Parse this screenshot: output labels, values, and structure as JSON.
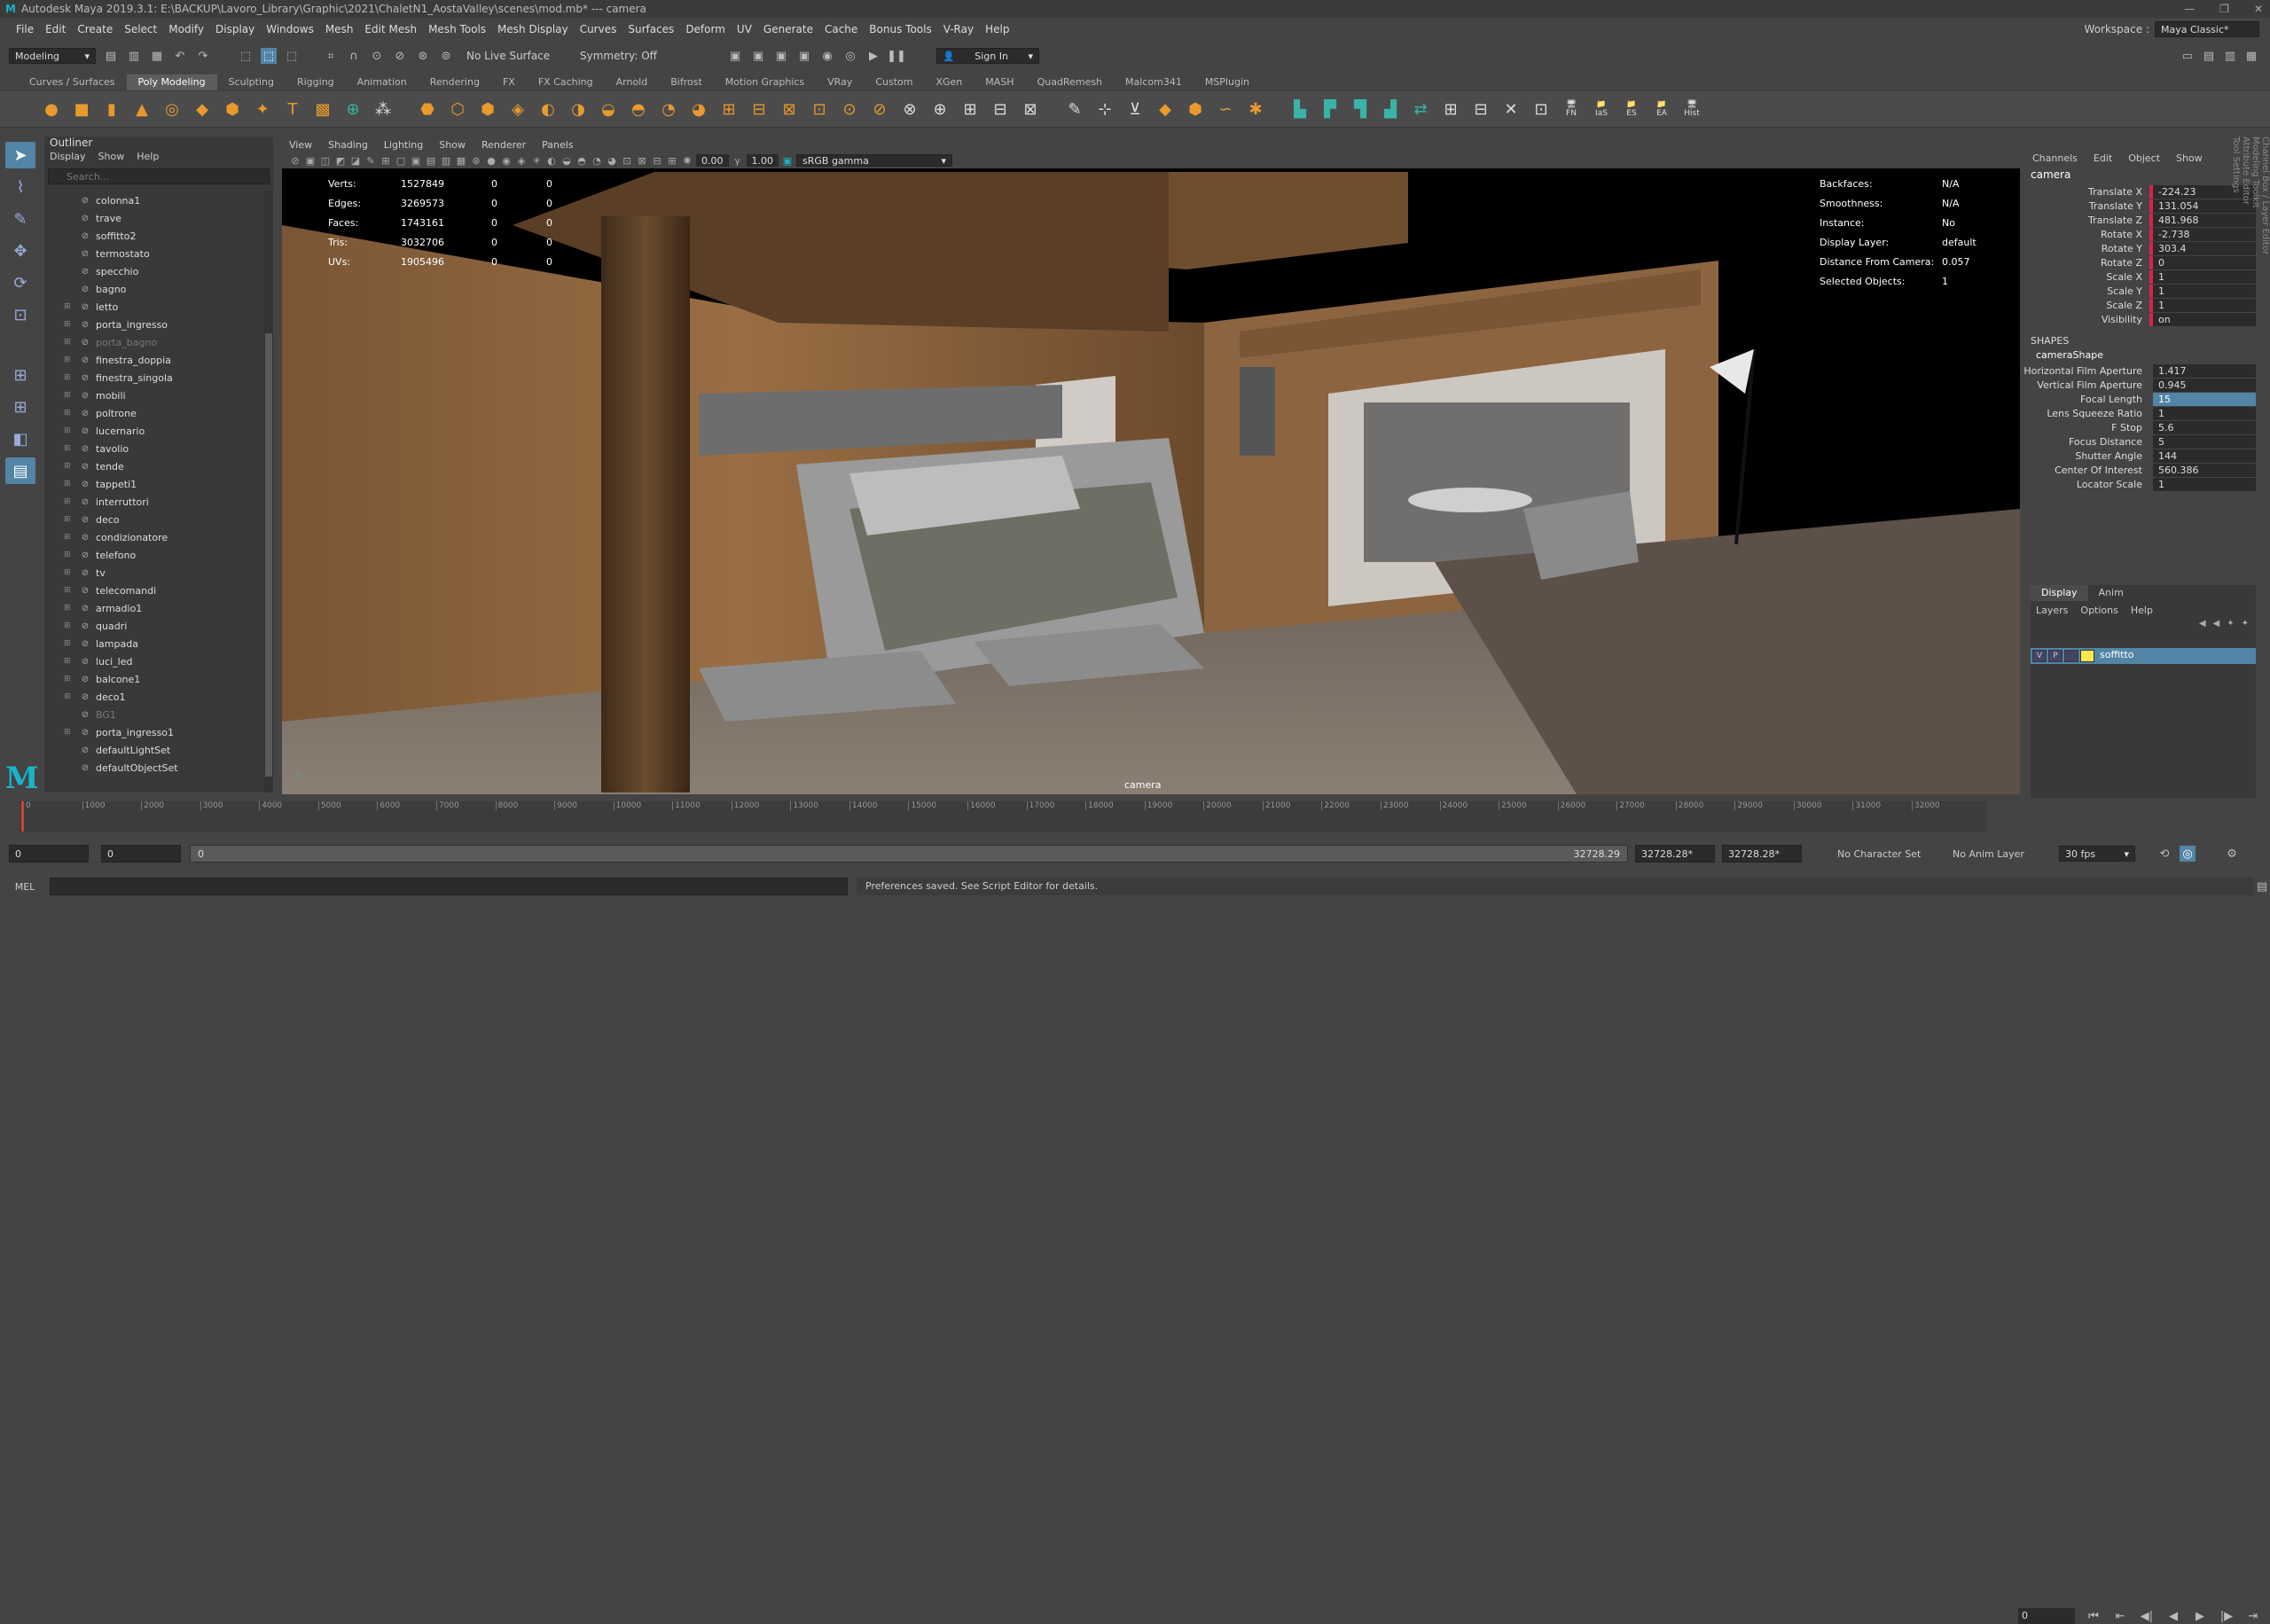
{
  "titlebar": {
    "logo": "M",
    "text": "Autodesk Maya 2019.3.1: E:\\BACKUP\\Lavoro_Library\\Graphic\\2021\\ChaletN1_AostaValley\\scenes\\mod.mb*   ---   camera"
  },
  "menus": [
    "File",
    "Edit",
    "Create",
    "Select",
    "Modify",
    "Display",
    "Windows",
    "Mesh",
    "Edit Mesh",
    "Mesh Tools",
    "Mesh Display",
    "Curves",
    "Surfaces",
    "Deform",
    "UV",
    "Generate",
    "Cache",
    "Bonus Tools",
    "V-Ray",
    "Help"
  ],
  "workspace": {
    "label": "Workspace :",
    "value": "Maya Classic*"
  },
  "statusline": {
    "mode": "Modeling",
    "live": "No Live Surface",
    "symmetry": "Symmetry: Off",
    "signin": "Sign In"
  },
  "shelf_tabs": [
    "Curves / Surfaces",
    "Poly Modeling",
    "Sculpting",
    "Rigging",
    "Animation",
    "Rendering",
    "FX",
    "FX Caching",
    "Arnold",
    "Bifrost",
    "Motion Graphics",
    "VRay",
    "Custom",
    "XGen",
    "MASH",
    "QuadRemesh",
    "Malcom341",
    "MSPlugin"
  ],
  "shelf_labels": {
    "fn": "FN",
    "ias": "IaS",
    "es": "ES",
    "ea": "EA",
    "hist": "Hist"
  },
  "outliner": {
    "title": "Outliner",
    "menu": [
      "Display",
      "Show",
      "Help"
    ],
    "search_placeholder": "Search...",
    "items": [
      {
        "name": "colonna1",
        "expand": false,
        "dim": false
      },
      {
        "name": "trave",
        "expand": false,
        "dim": false
      },
      {
        "name": "soffitto2",
        "expand": false,
        "dim": false
      },
      {
        "name": "termostato",
        "expand": false,
        "dim": false
      },
      {
        "name": "specchio",
        "expand": false,
        "dim": false
      },
      {
        "name": "bagno",
        "expand": false,
        "dim": false
      },
      {
        "name": "letto",
        "expand": true,
        "dim": false
      },
      {
        "name": "porta_ingresso",
        "expand": true,
        "dim": false
      },
      {
        "name": "porta_bagno",
        "expand": true,
        "dim": true
      },
      {
        "name": "finestra_doppia",
        "expand": true,
        "dim": false
      },
      {
        "name": "finestra_singola",
        "expand": true,
        "dim": false
      },
      {
        "name": "mobili",
        "expand": true,
        "dim": false
      },
      {
        "name": "poltrone",
        "expand": true,
        "dim": false
      },
      {
        "name": "lucernario",
        "expand": true,
        "dim": false
      },
      {
        "name": "tavolio",
        "expand": true,
        "dim": false
      },
      {
        "name": "tende",
        "expand": true,
        "dim": false
      },
      {
        "name": "tappeti1",
        "expand": true,
        "dim": false
      },
      {
        "name": "interruttori",
        "expand": true,
        "dim": false
      },
      {
        "name": "deco",
        "expand": true,
        "dim": false
      },
      {
        "name": "condizionatore",
        "expand": true,
        "dim": false
      },
      {
        "name": "telefono",
        "expand": true,
        "dim": false
      },
      {
        "name": "tv",
        "expand": true,
        "dim": false
      },
      {
        "name": "telecomandi",
        "expand": true,
        "dim": false
      },
      {
        "name": "armadio1",
        "expand": true,
        "dim": false
      },
      {
        "name": "quadri",
        "expand": true,
        "dim": false
      },
      {
        "name": "lampada",
        "expand": true,
        "dim": false
      },
      {
        "name": "luci_led",
        "expand": true,
        "dim": false
      },
      {
        "name": "balcone1",
        "expand": true,
        "dim": false
      },
      {
        "name": "deco1",
        "expand": true,
        "dim": false
      },
      {
        "name": "BG1",
        "expand": false,
        "dim": true
      },
      {
        "name": "porta_ingresso1",
        "expand": true,
        "dim": false
      },
      {
        "name": "defaultLightSet",
        "expand": false,
        "dim": false
      },
      {
        "name": "defaultObjectSet",
        "expand": false,
        "dim": false
      }
    ]
  },
  "viewport": {
    "menu": [
      "View",
      "Shading",
      "Lighting",
      "Show",
      "Renderer",
      "Panels"
    ],
    "exposure": "0.00",
    "gamma": "1.00",
    "colorspace": "sRGB gamma",
    "label": "camera",
    "hud_left": [
      {
        "k": "Verts:",
        "a": "1527849",
        "b": "0",
        "c": "0"
      },
      {
        "k": "Edges:",
        "a": "3269573",
        "b": "0",
        "c": "0"
      },
      {
        "k": "Faces:",
        "a": "1743161",
        "b": "0",
        "c": "0"
      },
      {
        "k": "Tris:",
        "a": "3032706",
        "b": "0",
        "c": "0"
      },
      {
        "k": "UVs:",
        "a": "1905496",
        "b": "0",
        "c": "0"
      }
    ],
    "hud_right": [
      {
        "k": "Backfaces:",
        "v": "N/A"
      },
      {
        "k": "Smoothness:",
        "v": "N/A"
      },
      {
        "k": "Instance:",
        "v": "No"
      },
      {
        "k": "Display Layer:",
        "v": "default"
      },
      {
        "k": "Distance From Camera:",
        "v": "0.057"
      },
      {
        "k": "Selected Objects:",
        "v": "1"
      }
    ]
  },
  "channelbox": {
    "menu": [
      "Channels",
      "Edit",
      "Object",
      "Show"
    ],
    "object": "camera",
    "channels": [
      {
        "k": "Translate X",
        "v": "-224.23"
      },
      {
        "k": "Translate Y",
        "v": "131.054"
      },
      {
        "k": "Translate Z",
        "v": "481.968"
      },
      {
        "k": "Rotate X",
        "v": "-2.738"
      },
      {
        "k": "Rotate Y",
        "v": "303.4"
      },
      {
        "k": "Rotate Z",
        "v": "0"
      },
      {
        "k": "Scale X",
        "v": "1"
      },
      {
        "k": "Scale Y",
        "v": "1"
      },
      {
        "k": "Scale Z",
        "v": "1"
      },
      {
        "k": "Visibility",
        "v": "on"
      }
    ],
    "shapes_label": "SHAPES",
    "shape_name": "cameraShape",
    "shape_channels": [
      {
        "k": "Horizontal Film Aperture",
        "v": "1.417"
      },
      {
        "k": "Vertical Film Aperture",
        "v": "0.945"
      },
      {
        "k": "Focal Length",
        "v": "15"
      },
      {
        "k": "Lens Squeeze Ratio",
        "v": "1"
      },
      {
        "k": "F Stop",
        "v": "5.6"
      },
      {
        "k": "Focus Distance",
        "v": "5"
      },
      {
        "k": "Shutter Angle",
        "v": "144"
      },
      {
        "k": "Center Of Interest",
        "v": "560.386"
      },
      {
        "k": "Locator Scale",
        "v": "1"
      }
    ]
  },
  "layers": {
    "tabs": [
      "Display",
      "Anim"
    ],
    "menu": [
      "Layers",
      "Options",
      "Help"
    ],
    "layer": {
      "v": "V",
      "p": "P",
      "name": "soffitto"
    }
  },
  "sidetabs": [
    "Channel Box / Layer Editor",
    "Modeling Toolkit",
    "Attribute Editor",
    "Tool Settings"
  ],
  "timeline": {
    "ticks": [
      "0",
      "1000",
      "2000",
      "3000",
      "4000",
      "5000",
      "6000",
      "7000",
      "8000",
      "9000",
      "10000",
      "11000",
      "12000",
      "13000",
      "14000",
      "15000",
      "16000",
      "17000",
      "18000",
      "19000",
      "20000",
      "21000",
      "22000",
      "23000",
      "24000",
      "25000",
      "26000",
      "27000",
      "28000",
      "29000",
      "30000",
      "31000",
      "32000"
    ],
    "current_frame": "0"
  },
  "range": {
    "start": "0",
    "start2": "0",
    "slider_start": "0",
    "slider_end": "32728.29",
    "end1": "32728.28*",
    "end2": "32728.28*",
    "character": "No Character Set",
    "anim_layer": "No Anim Layer",
    "fps": "30 fps"
  },
  "cmd": {
    "label": "MEL",
    "feedback": "Preferences saved. See Script Editor for details."
  }
}
